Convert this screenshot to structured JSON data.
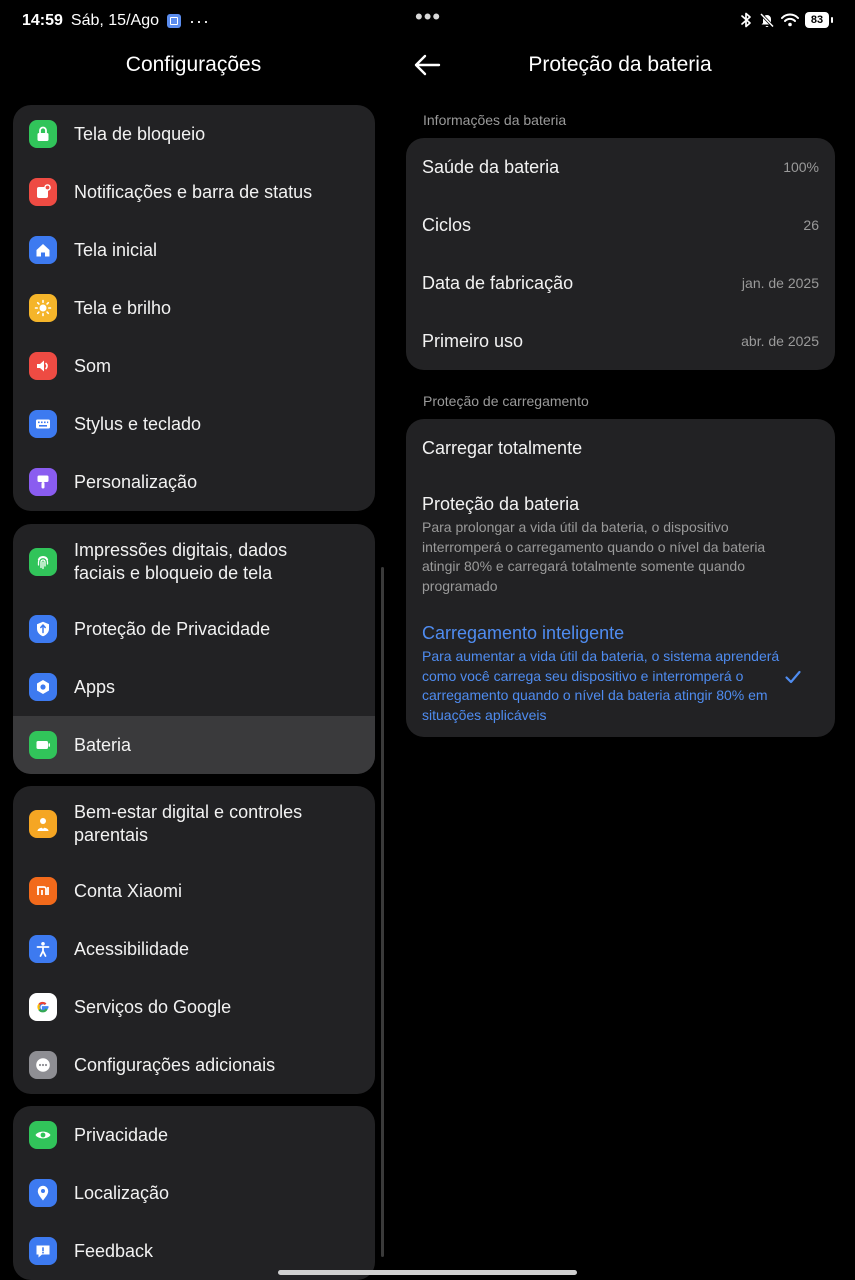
{
  "status_bar": {
    "time": "14:59",
    "date": "Sáb, 15/Ago",
    "more": "···",
    "battery_level": "83"
  },
  "left_panel": {
    "title": "Configurações",
    "groups": [
      {
        "items": [
          {
            "label": "Tela de bloqueio",
            "icon": "lock-icon",
            "color": "#31c45a"
          },
          {
            "label": "Notificações e barra de status",
            "icon": "notification-icon",
            "color": "#ee4b43"
          },
          {
            "label": "Tela inicial",
            "icon": "home-icon",
            "color": "#3d7af0"
          },
          {
            "label": "Tela e brilho",
            "icon": "sun-icon",
            "color": "#f5b52a"
          },
          {
            "label": "Som",
            "icon": "speaker-icon",
            "color": "#ee4b43"
          },
          {
            "label": "Stylus e teclado",
            "icon": "keyboard-icon",
            "color": "#3d7af0"
          },
          {
            "label": "Personalização",
            "icon": "brush-icon",
            "color": "#8a5cf0"
          }
        ]
      },
      {
        "items": [
          {
            "label": "Impressões digitais, dados faciais e bloqueio de tela",
            "icon": "fingerprint-icon",
            "color": "#31c45a"
          },
          {
            "label": "Proteção de Privacidade",
            "icon": "shield-icon",
            "color": "#3d7af0"
          },
          {
            "label": "Apps",
            "icon": "gear-icon",
            "color": "#3d7af0"
          },
          {
            "label": "Bateria",
            "icon": "battery-icon",
            "color": "#31c45a"
          }
        ]
      },
      {
        "items": [
          {
            "label": "Bem-estar digital e controles parentais",
            "icon": "wellbeing-icon",
            "color": "#f5a623"
          },
          {
            "label": "Conta Xiaomi",
            "icon": "xiaomi-icon",
            "color": "#f26a1b"
          },
          {
            "label": "Acessibilidade",
            "icon": "accessibility-icon",
            "color": "#3d7af0"
          },
          {
            "label": "Serviços do Google",
            "icon": "google-icon",
            "color": "#ffffff"
          },
          {
            "label": "Configurações adicionais",
            "icon": "more-icon",
            "color": "#8e8e93"
          }
        ]
      },
      {
        "items": [
          {
            "label": "Privacidade",
            "icon": "eye-icon",
            "color": "#31c45a"
          },
          {
            "label": "Localização",
            "icon": "location-icon",
            "color": "#3d7af0"
          },
          {
            "label": "Feedback",
            "icon": "feedback-icon",
            "color": "#3d7af0"
          }
        ]
      }
    ]
  },
  "right_panel": {
    "title": "Proteção da bateria",
    "battery_info_header": "Informações da bateria",
    "battery_info": [
      {
        "label": "Saúde da bateria",
        "value": "100%"
      },
      {
        "label": "Ciclos",
        "value": "26"
      },
      {
        "label": "Data de fabricação",
        "value": "jan. de 2025"
      },
      {
        "label": "Primeiro uso",
        "value": "abr. de 2025"
      }
    ],
    "charging_header": "Proteção de carregamento",
    "charging_options": [
      {
        "title": "Carregar totalmente",
        "description": ""
      },
      {
        "title": "Proteção da bateria",
        "description": "Para prolongar a vida útil da bateria, o dispositivo interromperá o carregamento quando o nível da bateria atingir 80% e carregará totalmente somente quando programado"
      },
      {
        "title": "Carregamento inteligente",
        "description": "Para aumentar a vida útil da bateria, o sistema aprenderá como você carrega seu dispositivo e interromperá o carregamento quando o nível da bateria atingir 80% em situações aplicáveis"
      }
    ],
    "selected_option": "Carregamento inteligente",
    "accent_color": "#4f8cf0"
  }
}
